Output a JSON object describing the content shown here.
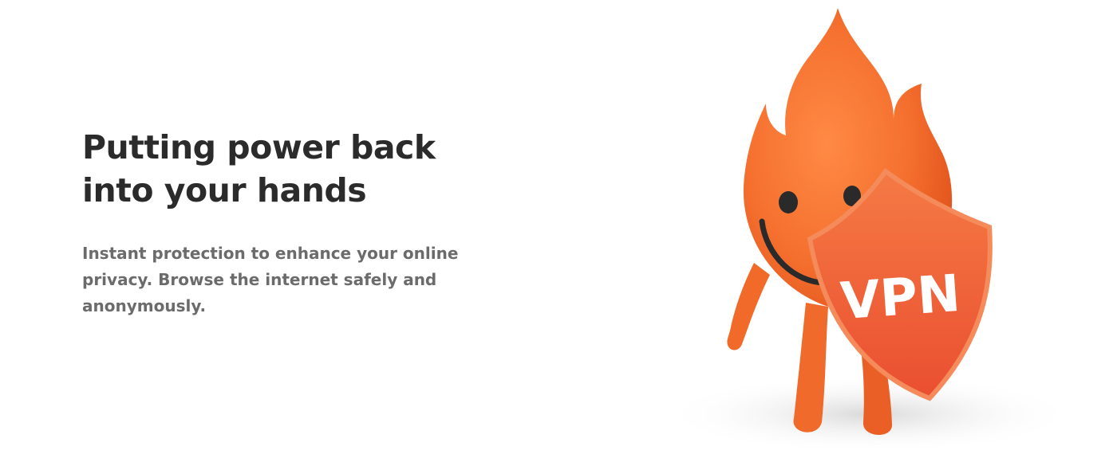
{
  "hero": {
    "headline_lines": [
      "Putting power back",
      "into your hands"
    ],
    "subtext_lines": [
      "Instant protection to enhance your online",
      "privacy. Browse the internet safely and",
      "anonymously."
    ]
  },
  "mascot": {
    "shield_text": "VPN",
    "colors": {
      "flame": "#f5702f",
      "flame_dark": "#e2541c",
      "shield": "#ee5a3a",
      "shield_rim": "#f47a4a",
      "face": "#2a2a2a"
    }
  }
}
